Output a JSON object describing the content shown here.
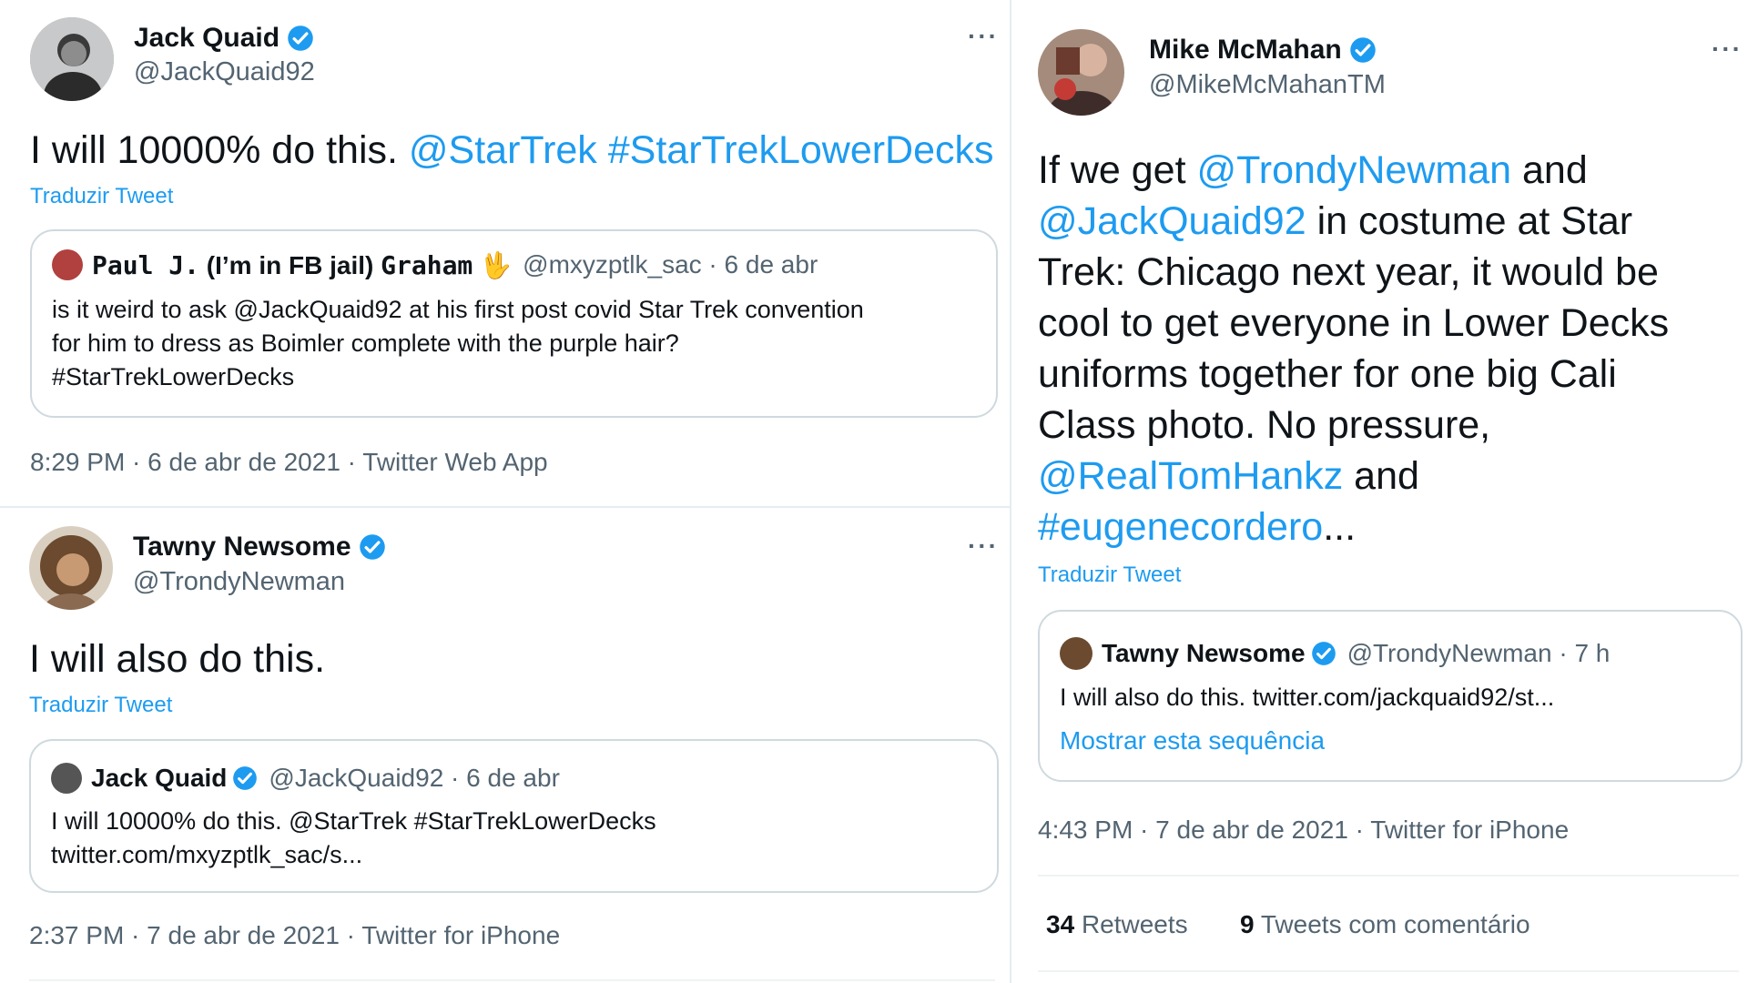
{
  "colors": {
    "link": "#1d9bf0",
    "secondary": "#536471",
    "border": "#cfd9de",
    "verified": "#1d9bf0"
  },
  "tweet1": {
    "author_name": "Jack Quaid",
    "author_handle": "@JackQuaid92",
    "text_plain": "I will 10000% do this. ",
    "text_link1": "@StarTrek",
    "text_link2": "#StarTrekLowerDecks",
    "translate": "Traduzir Tweet",
    "quote": {
      "name_mono1": "Paul J.",
      "name_mid": " (I’m in FB jail) ",
      "name_mono2": "Graham",
      "emoji": "🖖",
      "meta": "@mxyzptlk_sac · 6 de abr",
      "line1": "is it weird to ask @JackQuaid92 at his  first post covid  Star Trek convention",
      "line2": "for him to dress as Boimler complete with the purple hair?",
      "line3": "#StarTrekLowerDecks"
    },
    "meta": "8:29 PM · 6 de abr de 2021 · Twitter Web App"
  },
  "tweet2": {
    "author_name": "Tawny Newsome",
    "author_handle": "@TrondyNewman",
    "text": "I will also do this.",
    "translate": "Traduzir Tweet",
    "quote": {
      "name": "Jack Quaid",
      "meta": "@JackQuaid92 · 6 de abr",
      "line1": "I will 10000% do this. @StarTrek #StarTrekLowerDecks",
      "line2": "twitter.com/mxyzptlk_sac/s..."
    },
    "meta": "2:37 PM · 7 de abr de 2021 · Twitter for iPhone"
  },
  "tweet3": {
    "author_name": "Mike McMahan",
    "author_handle": "@MikeMcMahanTM",
    "text": {
      "a": "If we get ",
      "link1": "@TrondyNewman",
      "b": " and",
      "link2": "@JackQuaid92",
      "c": " in costume at Star",
      "line3": "Trek: Chicago next year, it would be",
      "line4": "cool to get everyone in Lower Decks",
      "line5": "uniforms together for one big Cali",
      "line6": "Class photo. No pressure,",
      "link3": "@RealTomHankz",
      "d": " and",
      "link4": "#eugenecordero",
      "e": "..."
    },
    "translate": "Traduzir Tweet",
    "quote": {
      "name": "Tawny Newsome",
      "meta": "@TrondyNewman · 7 h",
      "line1": "I will also do this. twitter.com/jackquaid92/st...",
      "show_thread": "Mostrar esta sequência"
    },
    "meta": "4:43 PM · 7 de abr de 2021 · Twitter for iPhone",
    "stats": {
      "retweets_count": "34",
      "retweets_label": "Retweets",
      "quotes_count": "9",
      "quotes_label": "Tweets com comentário"
    }
  },
  "more_label": "···"
}
